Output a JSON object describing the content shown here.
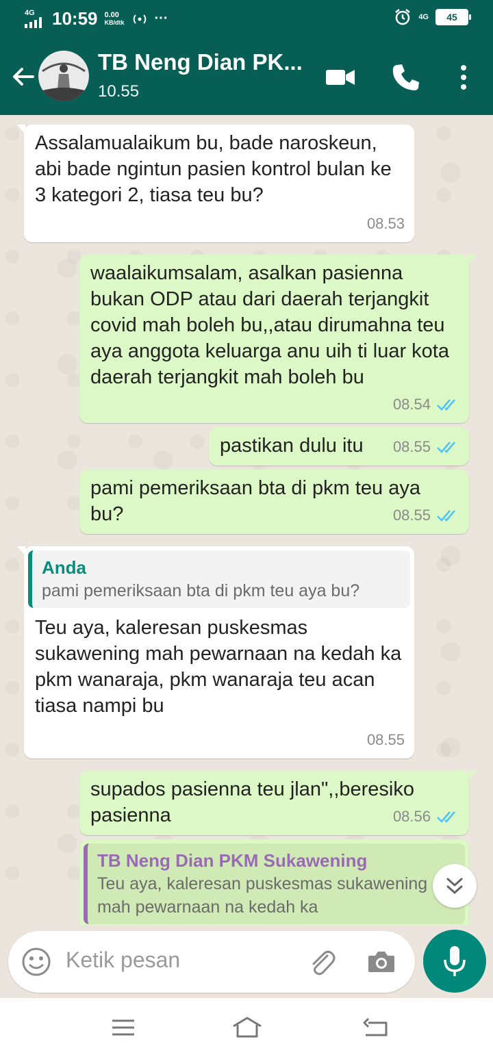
{
  "status_bar": {
    "network_left": "4G",
    "time": "10:59",
    "data_speed_value": "0.00",
    "data_speed_unit": "KB/dtk",
    "more": "···",
    "network_right": "4G",
    "battery": "45"
  },
  "header": {
    "name": "TB Neng Dian PK...",
    "last_seen": "10.55"
  },
  "messages": [
    {
      "text": "Assalamualaikum bu, bade naroskeun, abi bade ngintun pasien kontrol bulan ke 3 kategori 2, tiasa teu bu?",
      "time": "08.53"
    },
    {
      "text": "waalaikumsalam, asalkan pasienna bukan ODP atau dari daerah terjangkit covid mah boleh bu,,atau dirumahna teu aya anggota keluarga anu uih ti luar kota daerah terjangkit mah boleh bu",
      "time": "08.54"
    },
    {
      "text": "pastikan dulu itu",
      "time": "08.55"
    },
    {
      "text": "pami pemeriksaan bta di pkm teu aya bu?",
      "time": "08.55"
    },
    {
      "quote_name": "Anda",
      "quote_text": "pami pemeriksaan bta di pkm teu aya bu?",
      "text": "Teu aya, kaleresan puskesmas sukawening mah pewarnaan na kedah ka pkm wanaraja, pkm wanaraja teu acan tiasa nampi bu",
      "time": "08.55"
    },
    {
      "text": "supados pasienna teu jlan\",,beresiko pasienna",
      "time": "08.56"
    },
    {
      "quote_name": "TB Neng Dian PKM Sukawening",
      "quote_text": "Teu aya, kaleresan puskesmas sukawening mah pewarnaan na kedah ka"
    }
  ],
  "composer": {
    "placeholder": "Ketik pesan"
  },
  "colors": {
    "header": "#075e54",
    "outgoing_bubble": "#dcf8c6",
    "incoming_bubble": "#ffffff",
    "accent": "#00897b",
    "read_ticks": "#4fc3f7"
  },
  "icons": [
    "back-arrow-icon",
    "video-call-icon",
    "phone-icon",
    "more-options-icon",
    "emoji-icon",
    "attach-icon",
    "camera-icon",
    "mic-icon",
    "scroll-down-icon",
    "nav-menu-icon",
    "nav-home-icon",
    "nav-back-icon"
  ]
}
